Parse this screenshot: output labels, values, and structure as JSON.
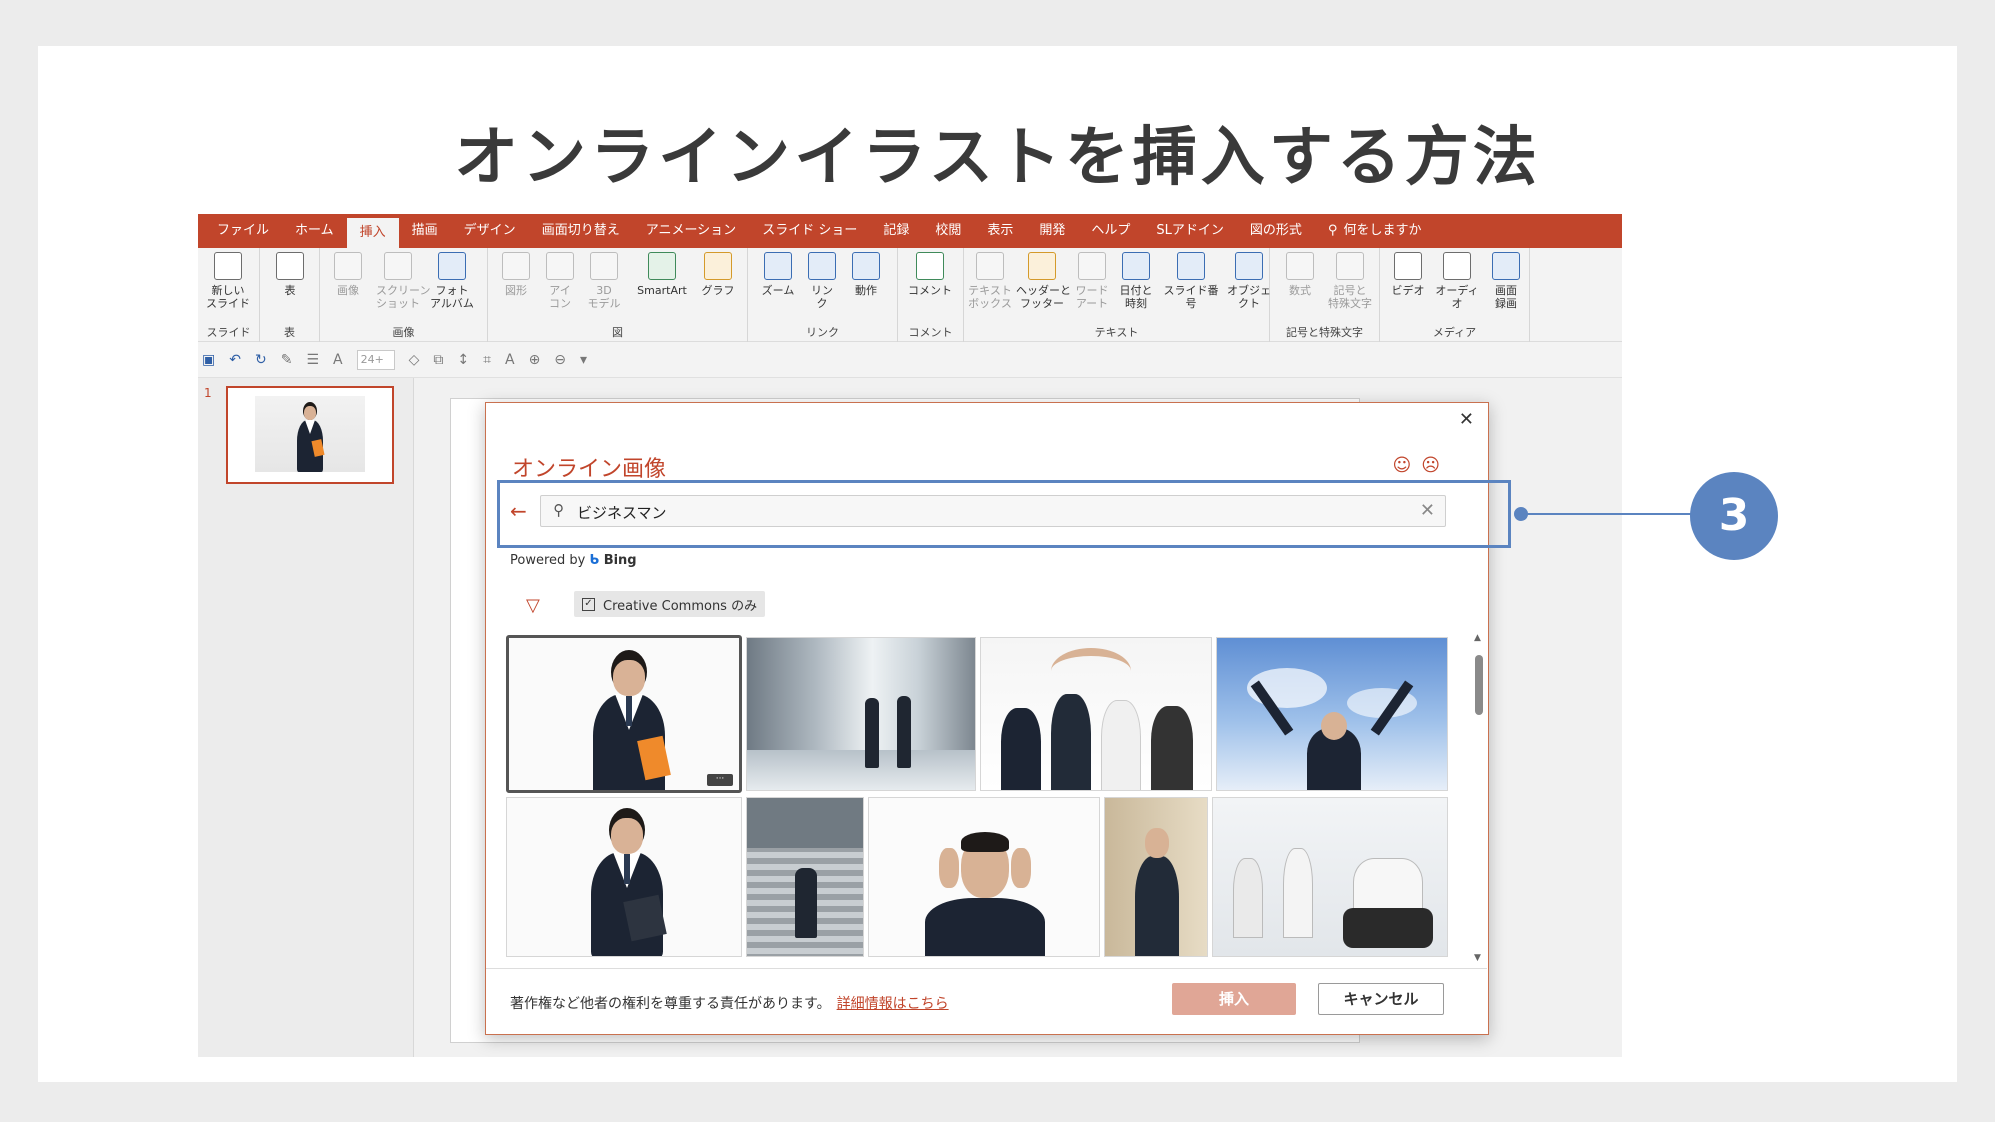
{
  "heading": "オンラインイラストを挿入する方法",
  "ribbon_tabs": [
    "ファイル",
    "ホーム",
    "挿入",
    "描画",
    "デザイン",
    "画面切り替え",
    "アニメーション",
    "スライド ショー",
    "記録",
    "校閲",
    "表示",
    "開発",
    "ヘルプ",
    "SLアドイン",
    "図の形式"
  ],
  "active_tab": "挿入",
  "tell_me": "何をしますか",
  "ribbon_groups": [
    {
      "label": "スライド",
      "buttons": [
        "新しい\nスライド"
      ]
    },
    {
      "label": "表",
      "buttons": [
        "表"
      ]
    },
    {
      "label": "画像",
      "buttons": [
        "画像",
        "スクリーン\nショット",
        "フォト\nアルバム"
      ]
    },
    {
      "label": "図",
      "buttons": [
        "図形",
        "アイ\nコン",
        "3D\nモデル",
        "SmartArt",
        "グラフ"
      ]
    },
    {
      "label": "リンク",
      "buttons": [
        "ズーム",
        "リン\nク",
        "動作"
      ]
    },
    {
      "label": "コメント",
      "buttons": [
        "コメント"
      ]
    },
    {
      "label": "テキスト",
      "buttons": [
        "テキスト\nボックス",
        "ヘッダーと\nフッター",
        "ワード\nアート",
        "日付と\n時刻",
        "スライド番号",
        "オブジェクト"
      ]
    },
    {
      "label": "記号と特殊文字",
      "buttons": [
        "数式",
        "記号と\n特殊文字"
      ]
    },
    {
      "label": "メディア",
      "buttons": [
        "ビデオ",
        "オーディオ",
        "画面\n録画"
      ]
    }
  ],
  "qat": {
    "font_size": "24+"
  },
  "slide_number": "1",
  "dialog": {
    "title": "オンライン画像",
    "search_value": "ビジネスマン",
    "powered_by": "Powered by",
    "bing": "Bing",
    "creative_commons": "Creative Commons のみ",
    "rights_text": "著作権など他者の権利を尊重する責任があります。",
    "rights_link": "詳細情報はこちら",
    "insert_label": "挿入",
    "cancel_label": "キャンセル"
  },
  "step_badge": "3",
  "colors": {
    "accent": "#c1452b",
    "callout": "#5b84c0"
  }
}
